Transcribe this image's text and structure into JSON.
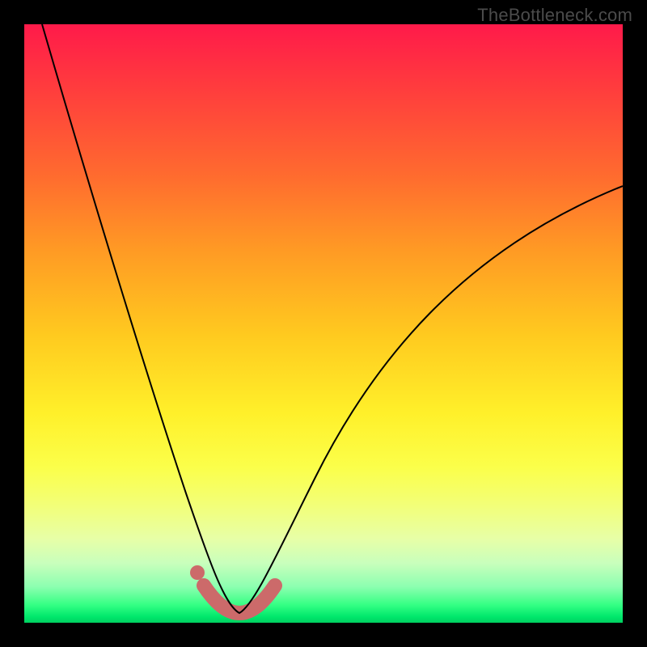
{
  "watermark": {
    "text": "TheBottleneck.com"
  },
  "chart_data": {
    "type": "line",
    "title": "",
    "xlabel": "",
    "ylabel": "",
    "xlim": [
      0,
      1
    ],
    "ylim": [
      0,
      1
    ],
    "legend_position": "none",
    "background": "vertical-gradient red→yellow→green",
    "series": [
      {
        "name": "curve",
        "x": [
          0.03,
          0.07,
          0.11,
          0.15,
          0.19,
          0.23,
          0.26,
          0.29,
          0.31,
          0.33,
          0.35,
          0.37,
          0.4,
          0.45,
          0.5,
          0.56,
          0.63,
          0.7,
          0.77,
          0.84,
          0.91,
          0.97,
          1.0
        ],
        "y": [
          1.0,
          0.86,
          0.72,
          0.58,
          0.44,
          0.31,
          0.2,
          0.11,
          0.06,
          0.03,
          0.02,
          0.02,
          0.03,
          0.08,
          0.16,
          0.26,
          0.37,
          0.47,
          0.56,
          0.63,
          0.68,
          0.72,
          0.73
        ],
        "min_at_x": 0.36
      }
    ],
    "accent": {
      "color": "#cc6a6a",
      "dot": {
        "x": 0.29,
        "y": 0.08
      },
      "segment_x_range": [
        0.3,
        0.42
      ]
    }
  }
}
